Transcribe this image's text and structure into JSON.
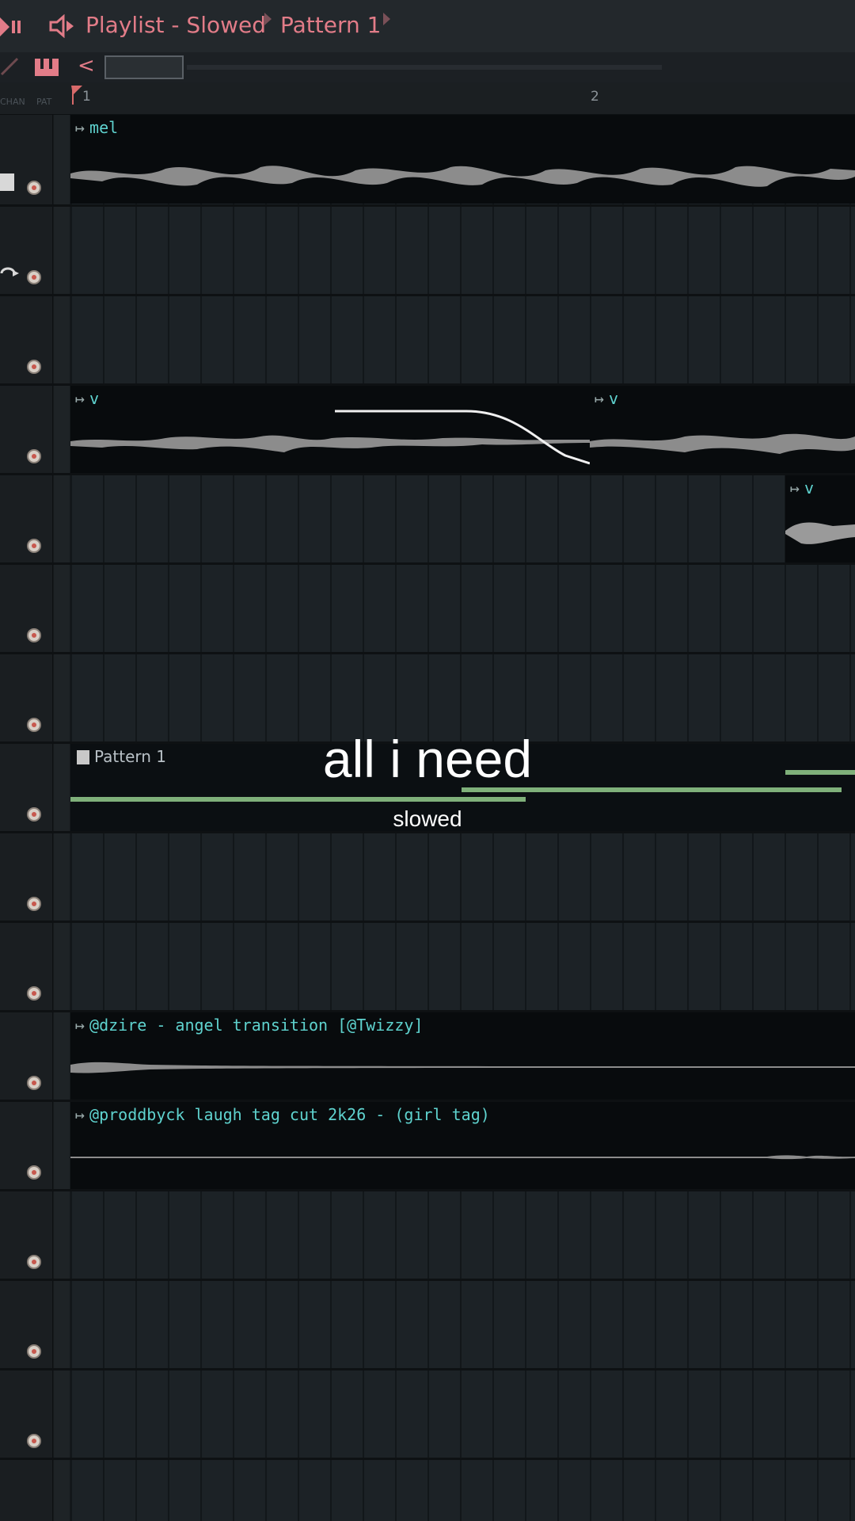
{
  "titlebar": {
    "title": "Playlist - Slowed",
    "pattern": "Pattern 1"
  },
  "toolbar": {
    "back": "<"
  },
  "ruler": {
    "bar_start": "1",
    "bar_next": "2",
    "col_chan": "CHAN",
    "col_pat": "PAT"
  },
  "clips": {
    "mel": "mel",
    "v1": "v",
    "v2": "v",
    "v3": "v",
    "pattern": "Pattern 1",
    "transition": "@dzire - angel transition [@Twizzy]",
    "laugh": "@proddbyck laugh tag cut 2k26 - (girl tag)"
  },
  "overlay": {
    "title": "all i need",
    "subtitle": "slowed"
  },
  "colors": {
    "accent": "#e27c88",
    "clip_label": "#5fd3cf",
    "pattern_note": "#7fb07a"
  }
}
